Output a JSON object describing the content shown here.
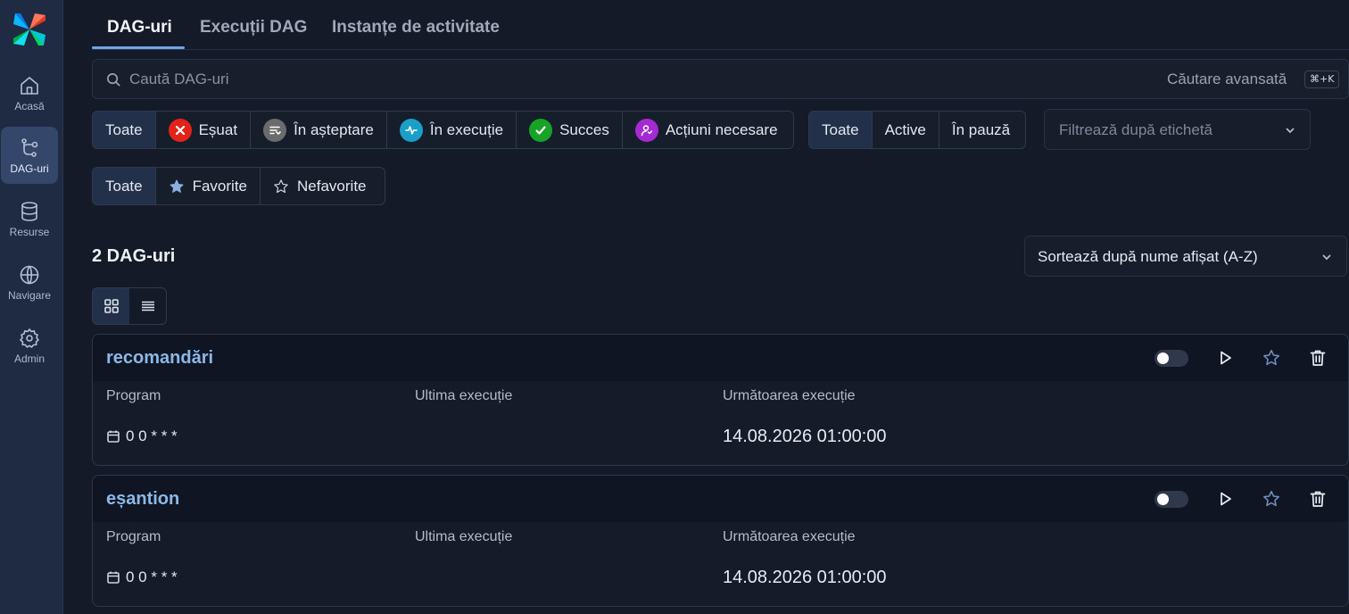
{
  "sidebar": {
    "items": [
      {
        "label": "Acasă",
        "icon": "home-icon"
      },
      {
        "label": "DAG-uri",
        "icon": "dag-icon"
      },
      {
        "label": "Resurse",
        "icon": "database-icon"
      },
      {
        "label": "Navigare",
        "icon": "globe-icon"
      },
      {
        "label": "Admin",
        "icon": "gear-icon"
      }
    ]
  },
  "tabs": [
    {
      "label": "DAG-uri"
    },
    {
      "label": "Execuții DAG"
    },
    {
      "label": "Instanțe de activitate"
    }
  ],
  "search": {
    "placeholder": "Caută DAG-uri",
    "advanced": "Căutare avansată",
    "shortcut": "⌘+K"
  },
  "state_filter": {
    "all": "Toate",
    "failed": "Eșuat",
    "queued": "În așteptare",
    "running": "În execuție",
    "success": "Succes",
    "needs_action": "Acțiuni necesare"
  },
  "active_filter": {
    "all": "Toate",
    "active": "Active",
    "paused": "În pauză"
  },
  "tag_filter": {
    "placeholder": "Filtrează după etichetă"
  },
  "fav_filter": {
    "all": "Toate",
    "favorites": "Favorite",
    "non_favorites": "Nefavorite"
  },
  "dag_count": "2 DAG-uri",
  "sort": {
    "label": "Sortează după nume afișat (A-Z)"
  },
  "columns": {
    "schedule": "Program",
    "last_run": "Ultima execuție",
    "next_run": "Următoarea execuție"
  },
  "dags": [
    {
      "name": "recomandări",
      "schedule": "0 0 * * *",
      "last_run": "",
      "next_run": "14.08.2026 01:00:00"
    },
    {
      "name": "eșantion",
      "schedule": "0 0 * * *",
      "last_run": "",
      "next_run": "14.08.2026 01:00:00"
    }
  ],
  "colors": {
    "accent": "#6ea6e6",
    "failed": "#e2231a",
    "queued": "#6b6b6b",
    "running": "#1aa0c8",
    "success": "#17a325",
    "needs_action": "#a62ad3"
  }
}
